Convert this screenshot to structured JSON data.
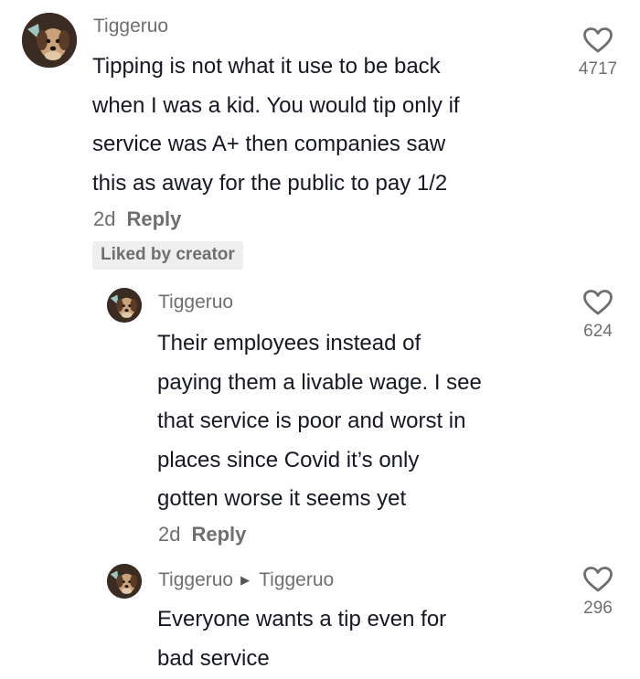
{
  "comments": [
    {
      "username": "Tiggeruo",
      "lines": [
        "Tipping is not what it use to be back",
        "when I was a kid. You would tip only if",
        "service was A+ then companies saw",
        "this as away for the public to pay 1/2"
      ],
      "date": "2d",
      "reply_label": "Reply",
      "badge": "Liked by creator",
      "likes": "4717"
    },
    {
      "username": "Tiggeruo",
      "lines": [
        "Their employees instead of",
        "paying them a livable wage. I see",
        "that service is poor and worst in",
        "places since Covid it’s only",
        "gotten worse it seems yet"
      ],
      "date": "2d",
      "reply_label": "Reply",
      "likes": "624"
    },
    {
      "username": "Tiggeruo",
      "reply_to": "Tiggeruo",
      "lines": [
        "Everyone wants a tip even for",
        "bad service"
      ],
      "likes": "296"
    }
  ],
  "icons": {
    "like": "heart-outline-icon",
    "reply_arrow": "triangle-right-icon",
    "avatar": "dog-photo"
  },
  "colors": {
    "text": "#161823",
    "secondary": "#6f6f72",
    "badge_bg": "#efefef"
  }
}
